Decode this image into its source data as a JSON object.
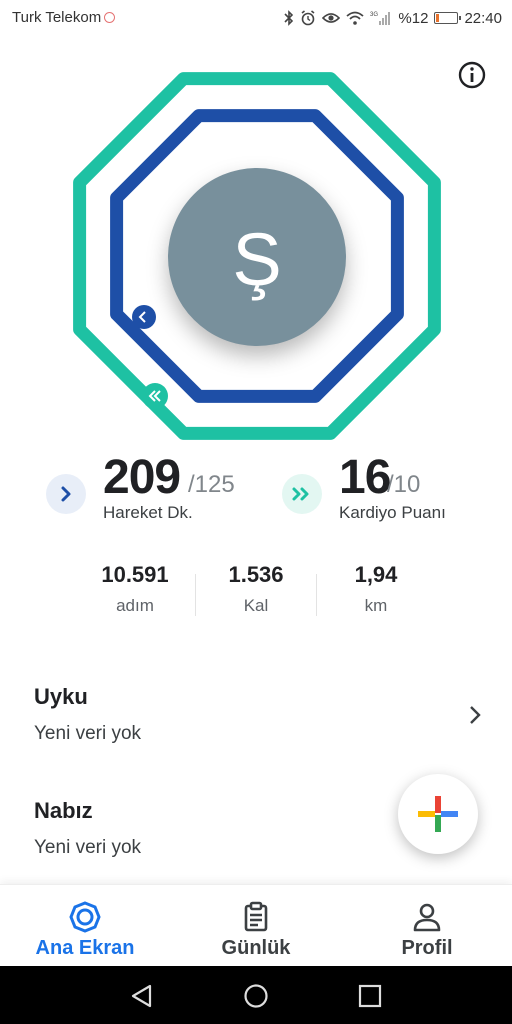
{
  "status_bar": {
    "carrier": "Turk Telekom",
    "battery": "%12",
    "battery_level": 0.12,
    "time": "22:40",
    "network": "3G",
    "icons": [
      "bluetooth-icon",
      "alarm-icon",
      "eye-icon",
      "wifi-icon",
      "signal-icon",
      "battery-icon"
    ]
  },
  "profile": {
    "initial": "Ş"
  },
  "rings": {
    "outer_color": "#1ec1a3",
    "inner_color": "#1e4fa7"
  },
  "goals": {
    "move": {
      "value": "209",
      "target": "/125",
      "label": "Hareket Dk."
    },
    "heart": {
      "value": "16",
      "target": "/10",
      "label": "Kardiyo Puanı"
    }
  },
  "stats": [
    {
      "value": "10.591",
      "unit": "adım"
    },
    {
      "value": "1.536",
      "unit": "Kal"
    },
    {
      "value": "1,94",
      "unit": "km"
    }
  ],
  "cards": [
    {
      "title": "Uyku",
      "subtitle": "Yeni veri yok"
    },
    {
      "title": "Nabız",
      "subtitle": "Yeni veri yok"
    }
  ],
  "bottom_nav": [
    {
      "label": "Ana Ekran",
      "icon": "home-rings-icon",
      "active": true
    },
    {
      "label": "Günlük",
      "icon": "journal-icon",
      "active": false
    },
    {
      "label": "Profil",
      "icon": "person-icon",
      "active": false
    }
  ],
  "colors": {
    "accent": "#1a73e8",
    "teal": "#1ec1a3",
    "navy": "#1e4fa7",
    "avatar": "#78909c"
  }
}
